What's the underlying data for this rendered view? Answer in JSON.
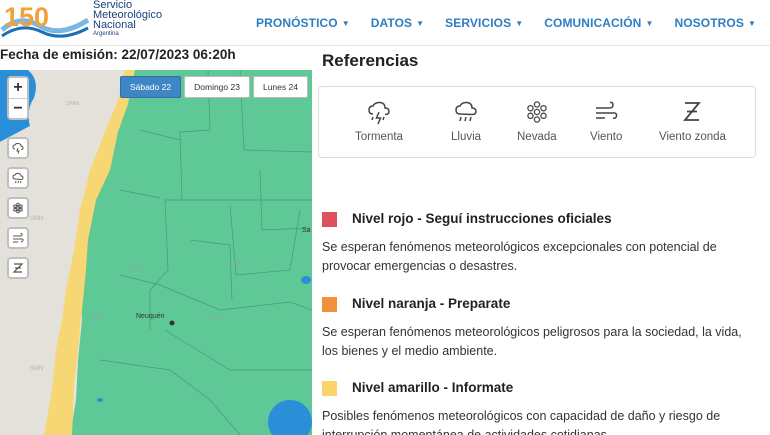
{
  "logo": {
    "number": "150",
    "line1": "Servicio",
    "line2": "Meteorológico",
    "line3": "Nacional",
    "line4": "Argentina"
  },
  "nav": [
    {
      "label": "PRONÓSTICO"
    },
    {
      "label": "DATOS"
    },
    {
      "label": "SERVICIOS"
    },
    {
      "label": "COMUNICACIÓN"
    },
    {
      "label": "NOSOTROS"
    }
  ],
  "issue_date": "Fecha de emisión: 22/07/2023 06:20h",
  "map": {
    "zoom_in": "+",
    "zoom_out": "−",
    "tabs": [
      {
        "label": "Sábado 22",
        "active": true
      },
      {
        "label": "Domingo 23",
        "active": false
      },
      {
        "label": "Lunes 24",
        "active": false
      }
    ],
    "city": "Neuquén",
    "city_sa": "Sa",
    "watermark": "SMN",
    "colors": {
      "green": "#5ec896",
      "yellow": "#f7d774",
      "water": "#2a8fd8",
      "land": "#e9e6df"
    }
  },
  "references": {
    "title": "Referencias",
    "items": [
      {
        "icon": "storm-icon",
        "label": "Tormenta"
      },
      {
        "icon": "rain-icon",
        "label": "Lluvia"
      },
      {
        "icon": "snow-icon",
        "label": "Nevada"
      },
      {
        "icon": "wind-icon",
        "label": "Viento"
      },
      {
        "icon": "zonda-icon",
        "label": "Viento zonda"
      }
    ]
  },
  "levels": [
    {
      "color": "#e0505f",
      "title": "Nivel rojo - Seguí instrucciones oficiales",
      "desc": "Se esperan fenómenos meteorológicos excepcionales con potencial de provocar emergencias o desastres."
    },
    {
      "color": "#f0913a",
      "title": "Nivel naranja - Preparate",
      "desc": "Se esperan fenómenos meteorológicos peligrosos para la sociedad, la vida, los bienes y el medio ambiente."
    },
    {
      "color": "#fad46b",
      "title": "Nivel amarillo - Informate",
      "desc": "Posibles fenómenos meteorológicos con capacidad de daño y riesgo de interrupción momentánea de actividades cotidianas."
    }
  ]
}
